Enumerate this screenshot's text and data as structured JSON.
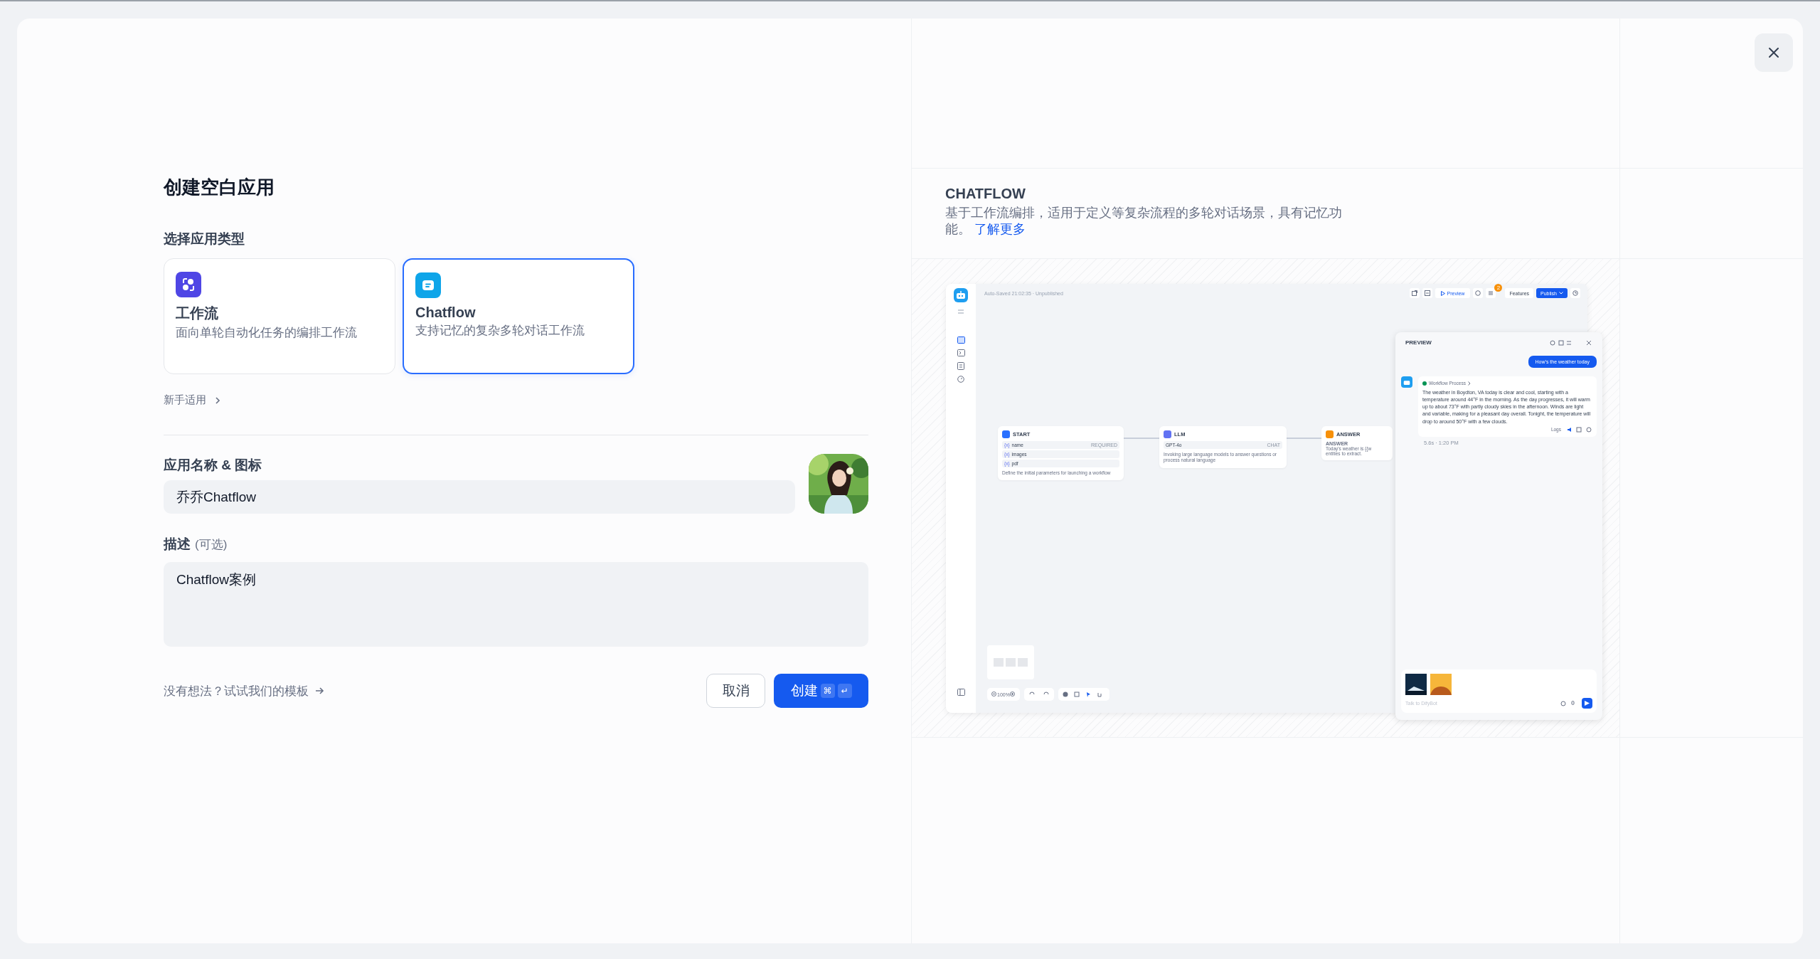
{
  "dialog": {
    "title": "创建空白应用",
    "app_type": {
      "label": "选择应用类型",
      "beginner_link": "新手适用",
      "options": [
        {
          "kind": "workflow",
          "name": "工作流",
          "description": "面向单轮自动化任务的编排工作流",
          "selected": false
        },
        {
          "kind": "chatflow",
          "name": "Chatflow",
          "description": "支持记忆的复杂多轮对话工作流",
          "selected": true
        }
      ]
    },
    "name_field": {
      "label": "应用名称 & 图标",
      "value": "乔乔Chatflow"
    },
    "description_field": {
      "label": "描述",
      "optional": "(可选)",
      "value": "Chatflow案例"
    },
    "template_link": "没有想法？试试我们的模板",
    "buttons": {
      "cancel": "取消",
      "create": "创建",
      "shortcut": [
        "⌘",
        "↵"
      ]
    }
  },
  "info": {
    "title": "CHATFLOW",
    "description": "基于工作流编排，适用于定义等复杂流程的多轮对话场景，具有记忆功能。",
    "link": "了解更多"
  },
  "preview_screenshot": {
    "status": "Auto-Saved 21:02:35 · Unpublished",
    "preview_button": "Preview",
    "badge": "2",
    "features_button": "Features",
    "publish_button": "Publish",
    "nodes": [
      {
        "kind": "start",
        "title": "START",
        "fields": [
          {
            "marker": "{x}",
            "name": "name",
            "tag": "REQUIRED"
          },
          {
            "marker": "{x}",
            "name": "images"
          },
          {
            "marker": "{x}",
            "name": "pdf"
          }
        ],
        "description": "Define the initial parameters for launching a workflow"
      },
      {
        "kind": "llm",
        "title": "LLM",
        "model": "GPT-4o",
        "mode": "CHAT",
        "description": "Invoking large language models to answer questions or process natural language"
      },
      {
        "kind": "answer",
        "title": "ANSWER",
        "label": "ANSWER",
        "lines": [
          "Today's weather is {{w",
          "entities to extract."
        ]
      }
    ],
    "zoom": "100%",
    "chat": {
      "title": "PREVIEW",
      "user_message": "How's the weather today",
      "process": "Workflow Process",
      "answer": "The weather in Boydton, VA today is clear and cool, starting with a temperature around 44°F in the morning. As the day progresses, it will warm up to about 73°F with partly cloudy skies in the afternoon. Winds are light and variable, making for a pleasant day overall. Tonight, the temperature will drop to around 50°F with a few clouds.",
      "logs": "Logs",
      "meta": "5.6s · 1:20 PM",
      "placeholder": "Talk to DifyBot"
    }
  }
}
